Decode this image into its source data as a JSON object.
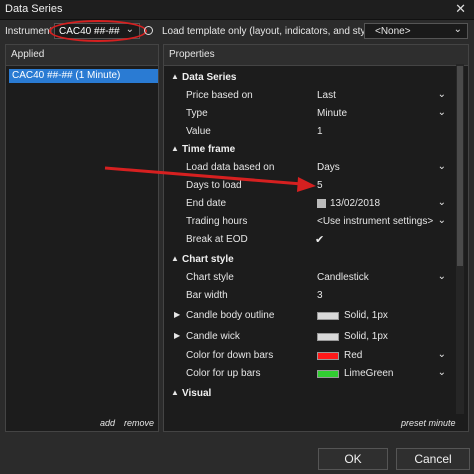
{
  "window": {
    "title": "Data Series"
  },
  "toprow": {
    "instrument_label": "Instrument",
    "instrument_value": "CAC40 ##-##",
    "template_label": "Load template only (layout, indicators, and style)",
    "template_value": "<None>"
  },
  "applied": {
    "header": "Applied",
    "items": [
      "CAC40 ##-## (1 Minute)"
    ],
    "add": "add",
    "remove": "remove"
  },
  "properties": {
    "header": "Properties",
    "data_series": {
      "title": "Data Series",
      "price_based_on": {
        "label": "Price based on",
        "value": "Last"
      },
      "type": {
        "label": "Type",
        "value": "Minute"
      },
      "value": {
        "label": "Value",
        "value": "1"
      }
    },
    "time_frame": {
      "title": "Time frame",
      "load_data": {
        "label": "Load data based on",
        "value": "Days"
      },
      "days_to_load": {
        "label": "Days to load",
        "value": "5"
      },
      "end_date": {
        "label": "End date",
        "value": "13/02/2018"
      },
      "trading_hours": {
        "label": "Trading hours",
        "value": "<Use instrument settings>"
      },
      "break_at_eod": {
        "label": "Break at EOD",
        "checked": true
      }
    },
    "chart_style": {
      "title": "Chart style",
      "chart_style": {
        "label": "Chart style",
        "value": "Candlestick"
      },
      "bar_width": {
        "label": "Bar width",
        "value": "3"
      },
      "candle_body_outline": {
        "label": "Candle body outline",
        "value": "Solid, 1px",
        "color": "#d9d9d9"
      },
      "candle_wick": {
        "label": "Candle wick",
        "value": "Solid, 1px",
        "color": "#d9d9d9"
      },
      "down_bars": {
        "label": "Color for down bars",
        "value": "Red",
        "color": "#ff1a1a"
      },
      "up_bars": {
        "label": "Color for up bars",
        "value": "LimeGreen",
        "color": "#32cd32"
      }
    },
    "visual": {
      "title": "Visual"
    },
    "preset": "preset minute"
  },
  "buttons": {
    "ok": "OK",
    "cancel": "Cancel"
  },
  "colors": {
    "annotation": "#d62020",
    "selection": "#2a7bd3"
  }
}
